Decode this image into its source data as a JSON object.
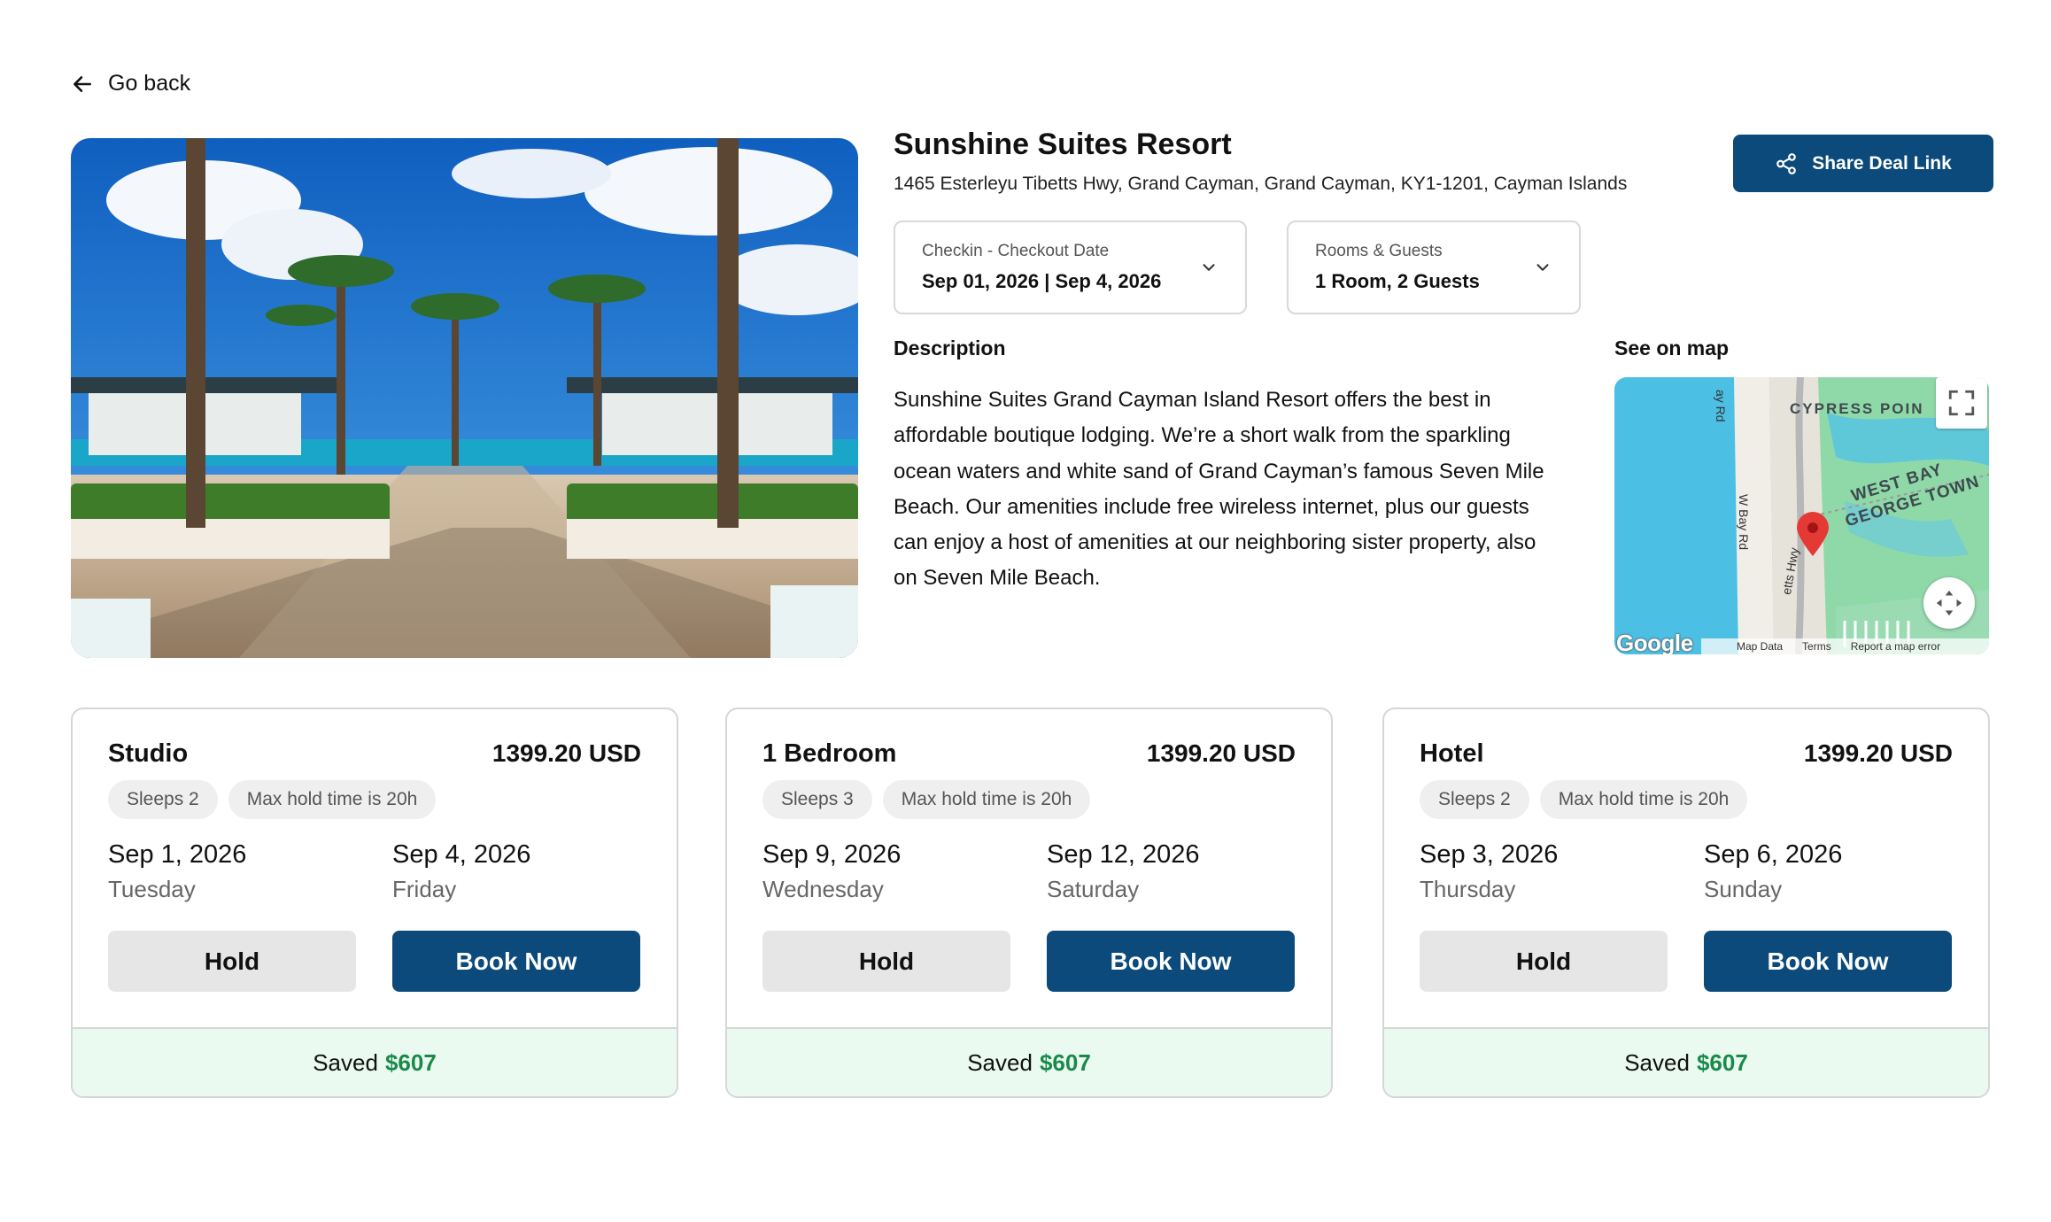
{
  "nav": {
    "back_label": "Go back",
    "back_icon": "arrow-left-icon"
  },
  "hotel": {
    "name": "Sunshine Suites Resort",
    "address": "1465 Esterleyu Tibetts Hwy, Grand Cayman, Grand Cayman, KY1-1201, Cayman Islands"
  },
  "share": {
    "label": "Share Deal Link",
    "icon": "share-icon"
  },
  "dates_selector": {
    "label": "Checkin - Checkout Date",
    "value": "Sep 01, 2026 | Sep 4, 2026"
  },
  "rooms_selector": {
    "label": "Rooms & Guests",
    "value": "1 Room, 2 Guests"
  },
  "description": {
    "heading": "Description",
    "text": "Sunshine Suites Grand Cayman Island Resort offers the best in affordable boutique lodging. We’re a short walk from the sparkling ocean waters and white sand of Grand Cayman’s famous Seven Mile Beach. Our amenities include free wireless internet, plus our guests can enjoy a host of amenities at our neighboring sister property, also on Seven Mile Beach."
  },
  "map": {
    "heading": "See on map",
    "labels": {
      "cypress": "CYPRESS POIN",
      "west_bay": "WEST BAY",
      "george_town": "GEORGE TOWN",
      "road1": "ay Rd",
      "road2": "W Bay Rd",
      "road3": "etts Hwy"
    },
    "google": "Google",
    "attribution": [
      "Map Data",
      "Terms",
      "Report a map error"
    ],
    "accent": "#e53935"
  },
  "cards": [
    {
      "room": "Studio",
      "price": "1399.20 USD",
      "chips": [
        "Sleeps 2",
        "Max hold time is 20h"
      ],
      "checkin_date": "Sep 1, 2026",
      "checkin_day": "Tuesday",
      "checkout_date": "Sep 4, 2026",
      "checkout_day": "Friday",
      "hold_label": "Hold",
      "book_label": "Book Now",
      "saved_label": "Saved",
      "saved_amount": "$607"
    },
    {
      "room": "1 Bedroom",
      "price": "1399.20 USD",
      "chips": [
        "Sleeps 3",
        "Max hold time is 20h"
      ],
      "checkin_date": "Sep 9, 2026",
      "checkin_day": "Wednesday",
      "checkout_date": "Sep 12, 2026",
      "checkout_day": "Saturday",
      "hold_label": "Hold",
      "book_label": "Book Now",
      "saved_label": "Saved",
      "saved_amount": "$607"
    },
    {
      "room": "Hotel",
      "price": "1399.20 USD",
      "chips": [
        "Sleeps 2",
        "Max hold time is 20h"
      ],
      "checkin_date": "Sep 3, 2026",
      "checkin_day": "Thursday",
      "checkout_date": "Sep 6, 2026",
      "checkout_day": "Sunday",
      "hold_label": "Hold",
      "book_label": "Book Now",
      "saved_label": "Saved",
      "saved_amount": "$607"
    }
  ],
  "colors": {
    "primary": "#0b4a7a",
    "saved_bg": "#eafaf0",
    "saved_text": "#1a8a4a"
  }
}
